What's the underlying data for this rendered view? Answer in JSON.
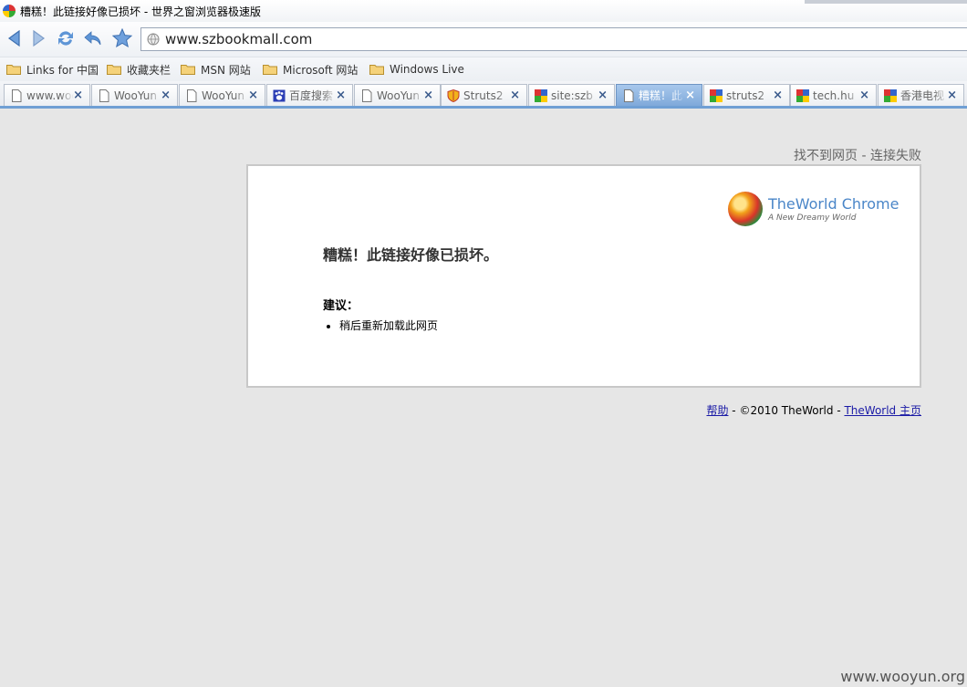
{
  "window": {
    "title": "糟糕！此链接好像已损坏 - 世界之窗浏览器极速版"
  },
  "toolbar": {
    "back": "back-arrow",
    "forward": "forward-arrow",
    "refresh": "refresh",
    "undo": "undo",
    "favorite": "star"
  },
  "address_bar": {
    "url": "www.szbookmall.com"
  },
  "favorites": [
    {
      "label": "Links for 中国"
    },
    {
      "label": "收藏夹栏"
    },
    {
      "label": "MSN 网站"
    },
    {
      "label": "Microsoft 网站"
    },
    {
      "label": "Windows Live"
    }
  ],
  "tabs": [
    {
      "label": "www.wooyun.org",
      "icon": "page"
    },
    {
      "label": "WooYun",
      "icon": "page"
    },
    {
      "label": "WooYun",
      "icon": "page"
    },
    {
      "label": "百度搜索",
      "icon": "baidu"
    },
    {
      "label": "WooYun",
      "icon": "page"
    },
    {
      "label": "Struts2",
      "icon": "shield"
    },
    {
      "label": "site:szb",
      "icon": "google"
    },
    {
      "label": "糟糕！此",
      "icon": "page",
      "active": true
    },
    {
      "label": "struts2",
      "icon": "google"
    },
    {
      "label": "tech.hu",
      "icon": "google"
    },
    {
      "label": "香港电视",
      "icon": "google"
    }
  ],
  "page": {
    "error_header": "找不到网页 - 连接失败",
    "logo_title_1": "TheWorld",
    "logo_title_2": " Chrome",
    "logo_slogan": "A New Dreamy World",
    "message": "糟糕！此链接好像已损坏。",
    "suggestion_title": "建议：",
    "suggestions": [
      "稍后重新加载此网页"
    ],
    "footer_help": "帮助",
    "footer_copyright": " - ©2010 TheWorld - ",
    "footer_home": "TheWorld 主页"
  },
  "watermark": "www.wooyun.org"
}
